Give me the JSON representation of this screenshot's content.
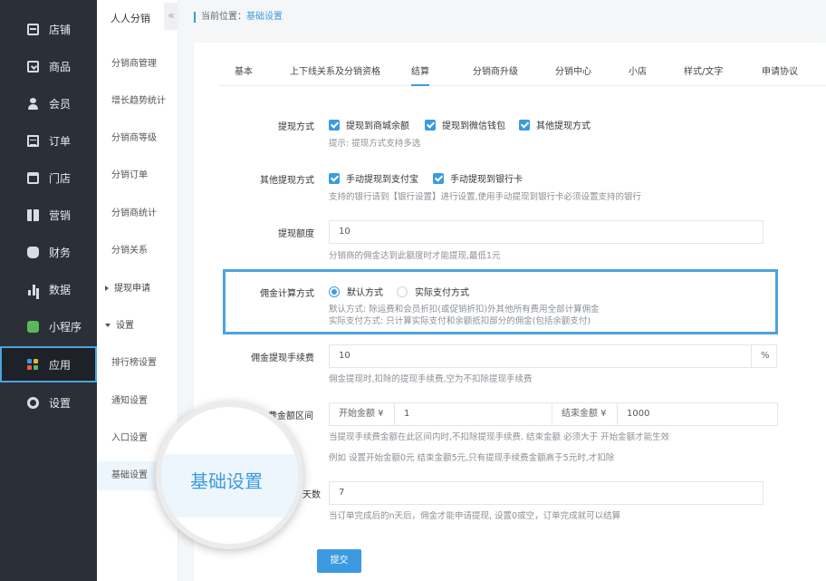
{
  "nav_main": {
    "items": [
      {
        "label": "店铺",
        "icon": "store-icon"
      },
      {
        "label": "商品",
        "icon": "goods-icon"
      },
      {
        "label": "会员",
        "icon": "member-icon"
      },
      {
        "label": "订单",
        "icon": "order-icon"
      },
      {
        "label": "门店",
        "icon": "shop-icon"
      },
      {
        "label": "营销",
        "icon": "gift-icon"
      },
      {
        "label": "财务",
        "icon": "money-bag-icon"
      },
      {
        "label": "数据",
        "icon": "bar-chart-icon"
      },
      {
        "label": "小程序",
        "icon": "mini-program-icon"
      },
      {
        "label": "应用",
        "icon": "apps-grid-icon"
      },
      {
        "label": "设置",
        "icon": "gear-icon"
      }
    ],
    "active": "应用"
  },
  "nav_sub": {
    "title": "人人分销",
    "collapse_glyph": "«",
    "items": [
      {
        "label": "分销商管理"
      },
      {
        "label": "增长趋势统计"
      },
      {
        "label": "分销商等级"
      },
      {
        "label": "分销订单"
      },
      {
        "label": "分销商统计"
      },
      {
        "label": "分销关系"
      },
      {
        "label": "提现申请"
      },
      {
        "label": "设置"
      },
      {
        "label": "排行榜设置"
      },
      {
        "label": "通知设置"
      },
      {
        "label": "入口设置"
      },
      {
        "label": "基础设置"
      }
    ],
    "active": "基础设置"
  },
  "breadcrumb": {
    "prefix": "当前位置：",
    "current": "基础设置"
  },
  "tabs": {
    "items": [
      "基本",
      "上下线关系及分销资格",
      "结算",
      "分销商升级",
      "分销中心",
      "小店",
      "样式/文字",
      "申请协议"
    ],
    "active": "结算"
  },
  "form": {
    "withdraw_method": {
      "label": "提现方式",
      "options": [
        "提现到商城余额",
        "提现到微信钱包",
        "其他提现方式"
      ],
      "hint": "提示: 提现方式支持多选"
    },
    "other_method": {
      "label": "其他提现方式",
      "options": [
        "手动提现到支付宝",
        "手动提现到银行卡"
      ],
      "hint": "支持的银行请到【银行设置】进行设置,使用手动提现到银行卡必须设置支持的银行"
    },
    "withdraw_limit": {
      "label": "提现额度",
      "value": "10",
      "hint": "分销商的佣金达到此额度时才能提现,最低1元"
    },
    "commission_calc": {
      "label": "佣金计算方式",
      "options": [
        "默认方式",
        "实际支付方式"
      ],
      "selected": "默认方式",
      "hint1": "默认方式: 除运费和会员折扣(或促销折扣)外其他所有费用全部计算佣金",
      "hint2": "实际支付方式: 只计算实际支付和余额抵扣部分的佣金(包括余额支付)"
    },
    "withdraw_fee": {
      "label": "佣金提现手续费",
      "value": "10",
      "suffix": "%",
      "hint": "佣金提现时,扣除的提现手续费,空为不扣除提现手续费"
    },
    "fee_range": {
      "label_visible": "费金额区间",
      "start_label": "开始金额 ¥",
      "start_value": "1",
      "end_label": "结束金额 ¥",
      "end_value": "1000",
      "hint1": "当提现手续费金额在此区间内时,不扣除提现手续费. 结束金额 必须大于 开始金额才能生效",
      "hint2": "例如 设置开始金额0元 结束金额5元,只有提现手续费金额高于5元时,才扣除"
    },
    "settle_days": {
      "label_visible": "天数",
      "value": "7",
      "hint": "当订单完成后的n天后，佣金才能申请提现, 设置0或空，订单完成就可以结算"
    },
    "submit_label": "提交"
  },
  "magnifier": {
    "text": "基础设置"
  },
  "colors": {
    "accent": "#3c9be0",
    "sidebar": "#2b3038",
    "highlight_border": "#4aa3df"
  }
}
